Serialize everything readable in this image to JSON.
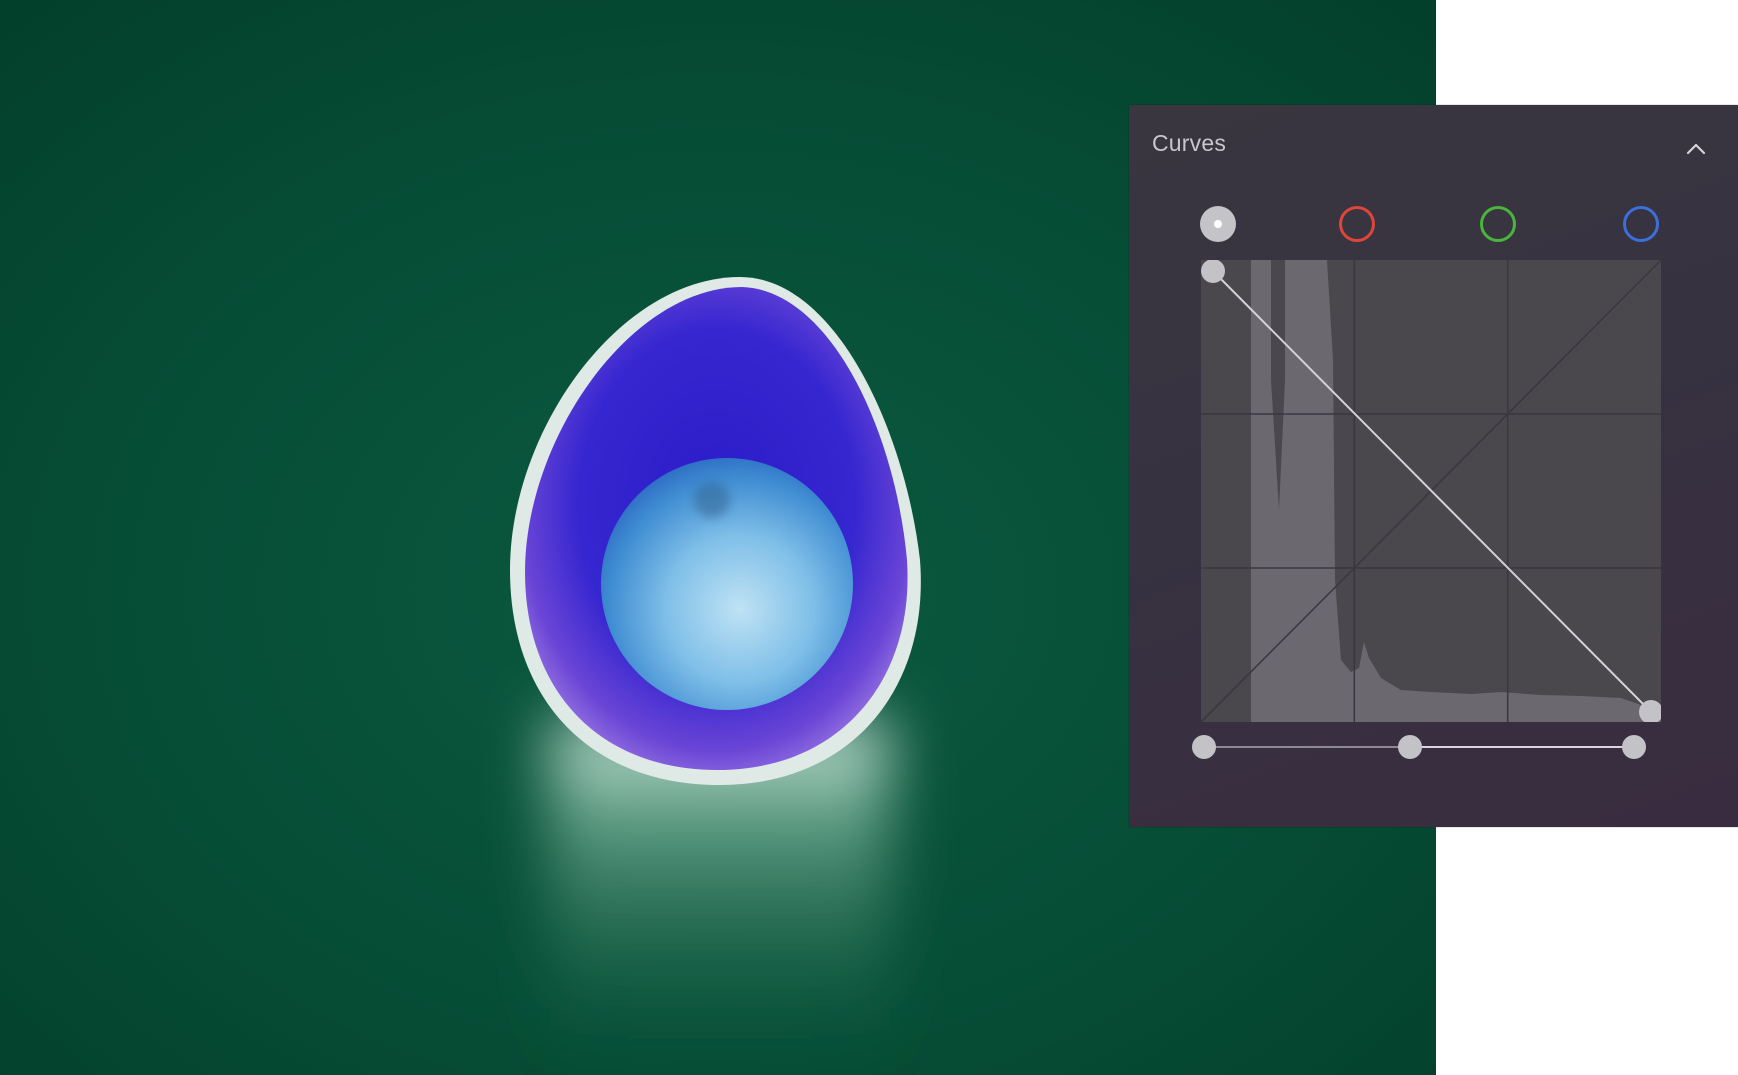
{
  "panel": {
    "title": "Curves",
    "collapse_icon": "chevron-up-icon",
    "channels": [
      {
        "name": "all",
        "color": "#c4c4c8",
        "selected": true
      },
      {
        "name": "red",
        "color": "#e0453c",
        "selected": false
      },
      {
        "name": "green",
        "color": "#49b53d",
        "selected": false
      },
      {
        "name": "blue",
        "color": "#3a6fdc",
        "selected": false
      }
    ],
    "curve": {
      "points": [
        [
          0,
          1
        ],
        [
          1,
          0
        ]
      ],
      "grid_divisions": 3
    },
    "levels": {
      "black": 0.0,
      "midtone": 0.48,
      "white": 1.0
    }
  },
  "colors": {
    "background_photo": "#044632",
    "egg_shell": "#3a2fd0",
    "yolk": "#5aa6e0",
    "panel_bg": "#38343f"
  }
}
